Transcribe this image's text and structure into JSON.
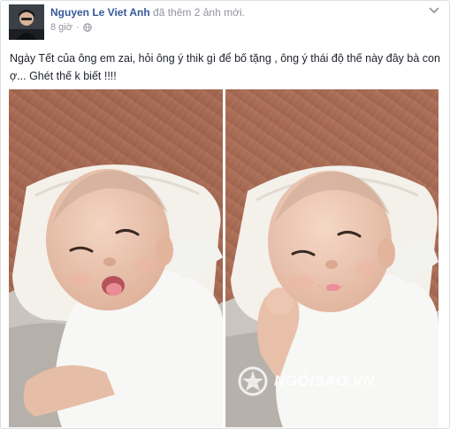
{
  "post": {
    "author_name": "Nguyen Le Viet Anh",
    "action_text": "đã thêm 2 ảnh mới.",
    "timestamp": "8 giờ",
    "text": "Ngày Tết của ông em zai, hỏi ông ý thik gì để bố tặng , ông ý thái độ thế này đây bà con ợ... Ghét thế k biết !!!!",
    "icons": {
      "privacy": "globe-icon",
      "menu": "chevron-down-icon"
    }
  },
  "photos": [
    {
      "label": "baby-photo-tongue-out"
    },
    {
      "label": "baby-photo-smiling"
    }
  ],
  "watermark": {
    "text": "NGÔISAO.VN"
  },
  "colors": {
    "author": "#365899",
    "meta": "#90949c",
    "text": "#1d2129",
    "border": "#dddfe2"
  }
}
